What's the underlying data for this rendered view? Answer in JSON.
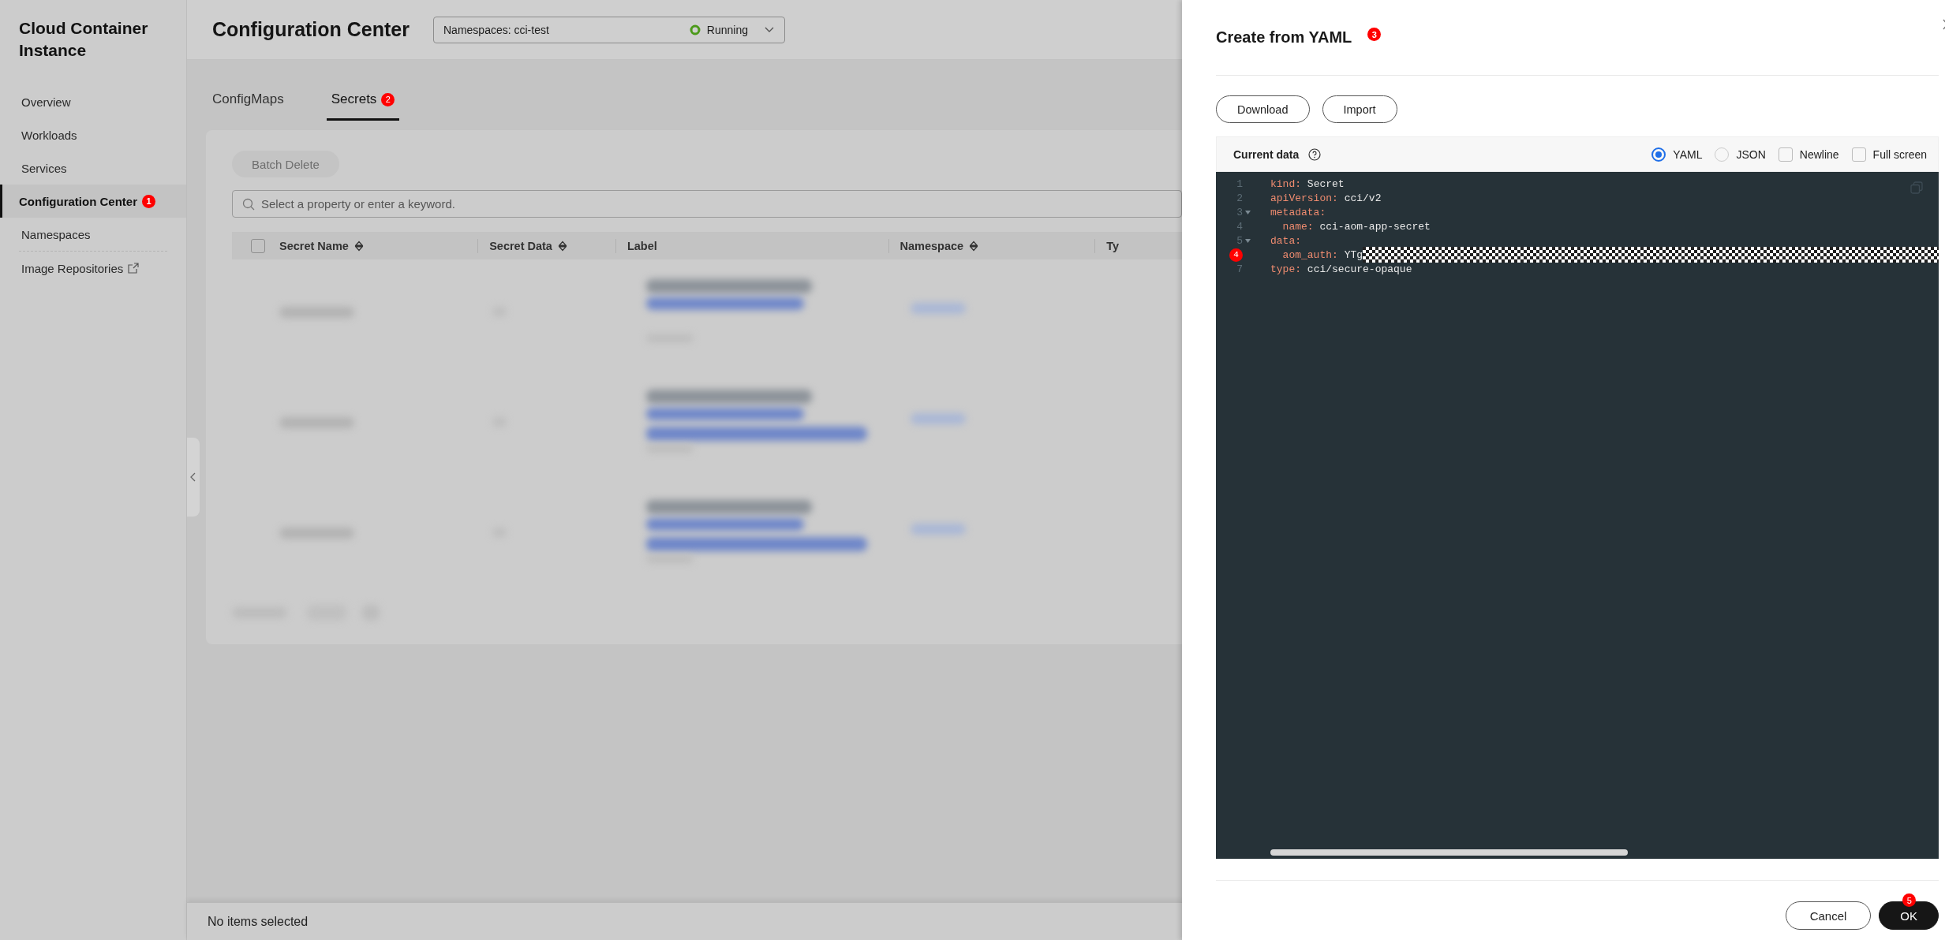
{
  "sidebar": {
    "title": "Cloud Container Instance",
    "items": [
      {
        "label": "Overview",
        "selected": false
      },
      {
        "label": "Workloads",
        "selected": false
      },
      {
        "label": "Services",
        "selected": false
      },
      {
        "label": "Configuration Center",
        "selected": true,
        "badge": "1"
      },
      {
        "label": "Namespaces",
        "selected": false
      },
      {
        "label": "Image Repositories",
        "selected": false,
        "external": true
      }
    ]
  },
  "header": {
    "title": "Configuration Center",
    "namespace": "Namespaces: cci-test",
    "status": "Running"
  },
  "tabs": [
    {
      "label": "ConfigMaps",
      "selected": false
    },
    {
      "label": "Secrets",
      "selected": true,
      "badge": "2"
    }
  ],
  "toolbar": {
    "batch_delete": {
      "label": "Batch Delete",
      "disabled": true
    },
    "search": {
      "placeholder": "Select a property or enter a keyword."
    }
  },
  "table": {
    "columns": [
      {
        "label": "Secret Name",
        "sortable": true
      },
      {
        "label": "Secret Data",
        "sortable": true
      },
      {
        "label": "Label",
        "sortable": false
      },
      {
        "label": "Namespace",
        "sortable": true
      },
      {
        "label": "Ty",
        "sortable": false
      }
    ],
    "select_all_checked": false,
    "rows": [
      {
        "kind": "blurred"
      },
      {
        "kind": "blurred"
      },
      {
        "kind": "blurred"
      }
    ]
  },
  "status_bar": "No items selected",
  "drawer": {
    "title": "Create from YAML",
    "badge": "3",
    "buttons": [
      "Download",
      "Import"
    ],
    "editor": {
      "label": "Current data",
      "formats": [
        {
          "label": "YAML",
          "selected": true
        },
        {
          "label": "JSON",
          "selected": false
        }
      ],
      "options": [
        {
          "label": "Newline",
          "checked": false
        },
        {
          "label": "Full screen",
          "checked": false
        }
      ],
      "lines": [
        {
          "number": "1",
          "key": "kind:",
          "value": "Secret",
          "foldable": false
        },
        {
          "number": "2",
          "key": "apiVersion:",
          "value": "cci/v2",
          "foldable": false
        },
        {
          "number": "3",
          "key": "metadata:",
          "foldable": true
        },
        {
          "number": "4",
          "key": "  name:",
          "value": "cci-aom-app-secret",
          "foldable": false
        },
        {
          "number": "5",
          "key": "data:",
          "foldable": true
        },
        {
          "badge": "4",
          "key": "  aom_auth:",
          "value": "YTg",
          "foldable": false,
          "redacted": true
        },
        {
          "number": "7",
          "key": "type:",
          "value": "cci/secure-opaque",
          "foldable": false
        }
      ]
    },
    "actions": [
      {
        "label": "Cancel",
        "kind": "secondary"
      },
      {
        "label": "OK",
        "kind": "primary",
        "badge": "5"
      }
    ]
  }
}
